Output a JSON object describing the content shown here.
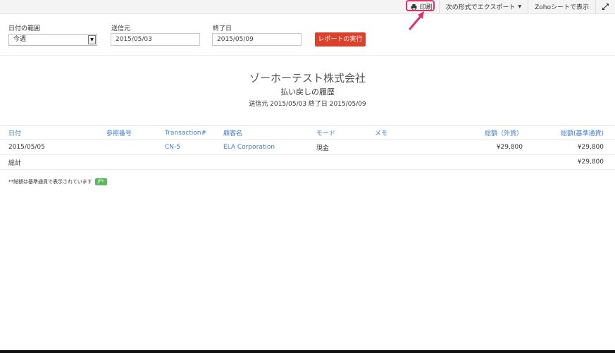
{
  "toolbar": {
    "print_label": "印刷",
    "export_label": "次の形式でエクスポート",
    "zoho_sheet_label": "Zohoシートで表示"
  },
  "filters": {
    "date_range_label": "日付の範囲",
    "date_range_value": "今週",
    "from_label": "送信元",
    "from_value": "2015/05/03",
    "to_label": "終了日",
    "to_value": "2015/05/09",
    "run_report_label": "レポートの実行"
  },
  "report": {
    "company": "ゾーホーテスト株式会社",
    "title": "払い戻しの履歴",
    "date_range": "送信元 2015/05/03 終了日 2015/05/09"
  },
  "table": {
    "headers": {
      "date": "日付",
      "reference": "参照番号",
      "transaction": "Transaction#",
      "customer": "顧客名",
      "mode": "モード",
      "memo": "メモ",
      "total_fcy": "総額（外貨）",
      "total_bcy": "総額(基準通貨)"
    },
    "rows": [
      {
        "date": "2015/05/05",
        "reference": "",
        "transaction": "CN-5",
        "customer": "ELA Corporation",
        "mode": "現金",
        "memo": "",
        "total_fcy": "¥29,800",
        "total_bcy": "¥29,800"
      }
    ],
    "total": {
      "label": "総計",
      "total_bcy": "¥29,800"
    }
  },
  "footnote": {
    "text": "**総額は基準通貨で表示されています",
    "currency_badge": "JPY"
  },
  "colors": {
    "accent_link": "#3d7fcc",
    "run_button": "#d9412b",
    "highlight": "#e0336e",
    "badge": "#5bb75b"
  }
}
